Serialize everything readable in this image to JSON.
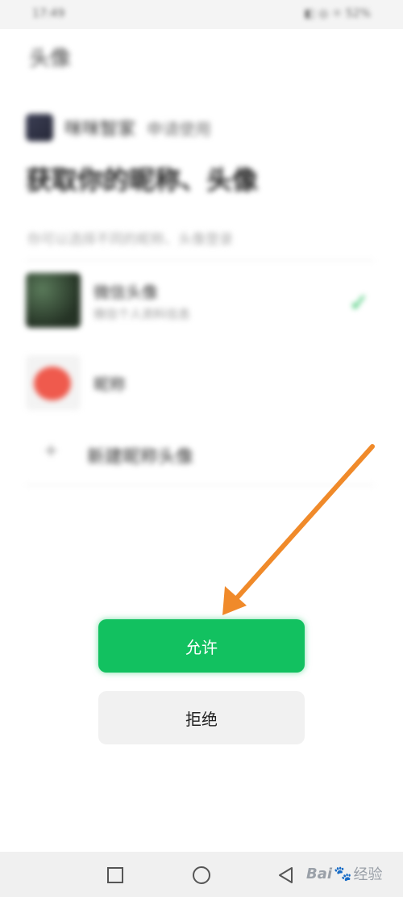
{
  "status_bar": {
    "time": "17:49",
    "right": "◧ ◎ ☼ 52%"
  },
  "page": {
    "title": "头像",
    "app_name": "咪咪智家",
    "app_sub": "申请使用",
    "headline": "获取你的昵称、头像",
    "hint": "你可以选择不同的昵称、头像登录",
    "options": [
      {
        "label": "微信头像",
        "sub": "微信个人资料信息",
        "selected": true
      },
      {
        "label": "昵称"
      },
      {
        "label": "新建昵称头像"
      }
    ]
  },
  "buttons": {
    "allow": "允许",
    "deny": "拒绝"
  },
  "watermark": {
    "brand_a": "Bai",
    "brand_b": "经验"
  },
  "colors": {
    "accent": "#12c160",
    "arrow": "#f08a2a"
  }
}
